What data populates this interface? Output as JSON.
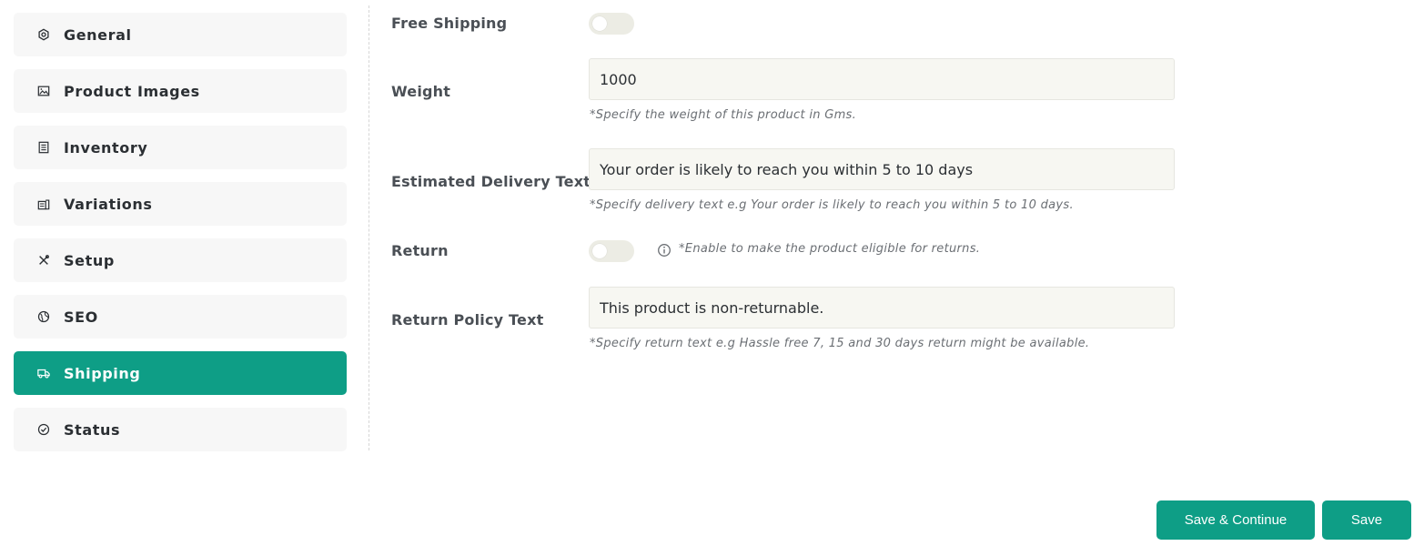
{
  "sidebar": {
    "items": [
      {
        "label": "General",
        "icon": "settings-hex-icon",
        "active": false
      },
      {
        "label": "Product Images",
        "icon": "image-icon",
        "active": false
      },
      {
        "label": "Inventory",
        "icon": "document-icon",
        "active": false
      },
      {
        "label": "Variations",
        "icon": "variations-icon",
        "active": false
      },
      {
        "label": "Setup",
        "icon": "tools-icon",
        "active": false
      },
      {
        "label": "SEO",
        "icon": "globe-icon",
        "active": false
      },
      {
        "label": "Shipping",
        "icon": "truck-icon",
        "active": true
      },
      {
        "label": "Status",
        "icon": "check-circle-icon",
        "active": false
      }
    ]
  },
  "form": {
    "free_shipping": {
      "label": "Free Shipping",
      "enabled": false
    },
    "weight": {
      "label": "Weight",
      "value": "1000",
      "help": "*Specify the weight of this product in Gms."
    },
    "delivery_text": {
      "label": "Estimated Delivery Text",
      "value": "Your order is likely to reach you within 5 to 10 days",
      "help": "*Specify delivery text e.g Your order is likely to reach you within 5 to 10 days."
    },
    "return": {
      "label": "Return",
      "enabled": false,
      "help": "*Enable to make the product eligible for returns."
    },
    "return_policy": {
      "label": "Return Policy Text",
      "value": "This product is non-returnable.",
      "help": "*Specify return text e.g Hassle free 7, 15 and 30 days return might be available."
    }
  },
  "actions": {
    "save_continue": "Save & Continue",
    "save": "Save"
  },
  "colors": {
    "accent": "#0e9e86",
    "sidebar_bg": "#f7f7f7",
    "input_bg": "#f7f7f2"
  }
}
